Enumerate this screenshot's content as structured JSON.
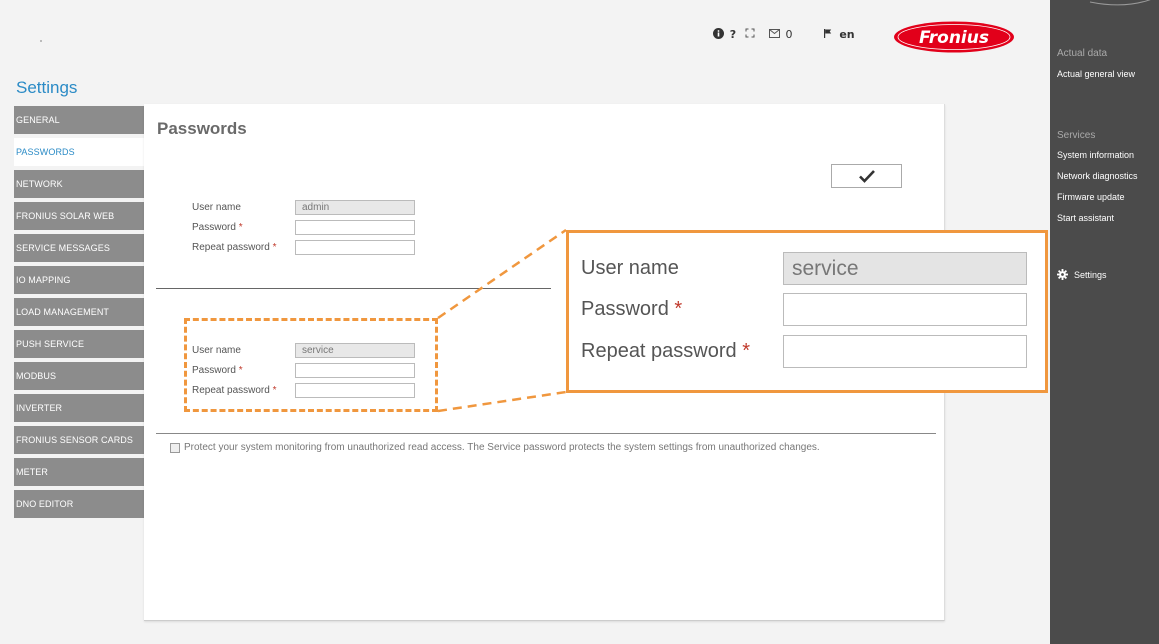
{
  "toolbar": {
    "info_icon": "info-icon",
    "help_label": "?",
    "fullscreen_icon": "fullscreen-icon",
    "messages_count": "0",
    "language": "en",
    "brand": "Fronius",
    "brand_color": "#e2001a"
  },
  "page": {
    "section_title": "Settings",
    "title": "Passwords",
    "accent_color": "#2b8bc6",
    "highlight_color": "#f0973e"
  },
  "left_nav": [
    {
      "label": "GENERAL",
      "active": false
    },
    {
      "label": "PASSWORDS",
      "active": true
    },
    {
      "label": "NETWORK",
      "active": false
    },
    {
      "label": "FRONIUS SOLAR WEB",
      "active": false
    },
    {
      "label": "SERVICE MESSAGES",
      "active": false
    },
    {
      "label": "IO MAPPING",
      "active": false
    },
    {
      "label": "LOAD MANAGEMENT",
      "active": false
    },
    {
      "label": "PUSH SERVICE",
      "active": false
    },
    {
      "label": "MODBUS",
      "active": false
    },
    {
      "label": "INVERTER",
      "active": false
    },
    {
      "label": "FRONIUS SENSOR CARDS",
      "active": false
    },
    {
      "label": "METER",
      "active": false
    },
    {
      "label": "DNO EDITOR",
      "active": false
    }
  ],
  "admin_form": {
    "username_label": "User name",
    "username_value": "admin",
    "password_label": "Password",
    "repeat_label": "Repeat password",
    "required_mark": "*"
  },
  "service_form": {
    "username_label": "User name",
    "username_value": "service",
    "password_label": "Password",
    "repeat_label": "Repeat password",
    "required_mark": "*"
  },
  "notice": "Protect your system monitoring from unauthorized read access. The Service password protects the system settings from unauthorized changes.",
  "right_nav": {
    "actual_data_header": "Actual data",
    "actual_general_view": "Actual general view",
    "services_header": "Services",
    "services": [
      "System information",
      "Network diagnostics",
      "Firmware update",
      "Start assistant"
    ],
    "settings_label": "Settings"
  }
}
